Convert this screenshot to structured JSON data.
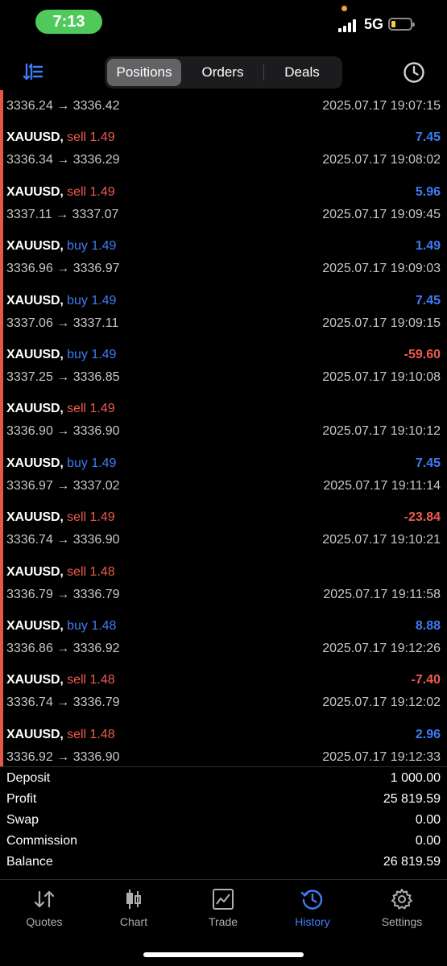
{
  "status": {
    "time": "7:13",
    "network": "5G"
  },
  "toolbar": {
    "segments": [
      {
        "label": "Positions",
        "active": true
      },
      {
        "label": "Orders",
        "active": false
      },
      {
        "label": "Deals",
        "active": false
      }
    ]
  },
  "deals": [
    {
      "symbol": "",
      "side": "",
      "volume": "",
      "prices": "3336.24 → 3336.42",
      "profit": "",
      "time": "2025.07.17 19:07:15"
    },
    {
      "symbol": "XAUUSD,",
      "side": "sell",
      "volume": "1.49",
      "prices": "3336.34 → 3336.29",
      "profit": "7.45",
      "time": "2025.07.17 19:08:02"
    },
    {
      "symbol": "XAUUSD,",
      "side": "sell",
      "volume": "1.49",
      "prices": "3337.11 → 3337.07",
      "profit": "5.96",
      "time": "2025.07.17 19:09:45"
    },
    {
      "symbol": "XAUUSD,",
      "side": "buy",
      "volume": "1.49",
      "prices": "3336.96 → 3336.97",
      "profit": "1.49",
      "time": "2025.07.17 19:09:03"
    },
    {
      "symbol": "XAUUSD,",
      "side": "buy",
      "volume": "1.49",
      "prices": "3337.06 → 3337.11",
      "profit": "7.45",
      "time": "2025.07.17 19:09:15"
    },
    {
      "symbol": "XAUUSD,",
      "side": "buy",
      "volume": "1.49",
      "prices": "3337.25 → 3336.85",
      "profit": "-59.60",
      "time": "2025.07.17 19:10:08"
    },
    {
      "symbol": "XAUUSD,",
      "side": "sell",
      "volume": "1.49",
      "prices": "3336.90 → 3336.90",
      "profit": "",
      "time": "2025.07.17 19:10:12"
    },
    {
      "symbol": "XAUUSD,",
      "side": "buy",
      "volume": "1.49",
      "prices": "3336.97 → 3337.02",
      "profit": "7.45",
      "time": "2025.07.17 19:11:14"
    },
    {
      "symbol": "XAUUSD,",
      "side": "sell",
      "volume": "1.49",
      "prices": "3336.74 → 3336.90",
      "profit": "-23.84",
      "time": "2025.07.17 19:10:21"
    },
    {
      "symbol": "XAUUSD,",
      "side": "sell",
      "volume": "1.48",
      "prices": "3336.79 → 3336.79",
      "profit": "",
      "time": "2025.07.17 19:11:58"
    },
    {
      "symbol": "XAUUSD,",
      "side": "buy",
      "volume": "1.48",
      "prices": "3336.86 → 3336.92",
      "profit": "8.88",
      "time": "2025.07.17 19:12:26"
    },
    {
      "symbol": "XAUUSD,",
      "side": "sell",
      "volume": "1.48",
      "prices": "3336.74 → 3336.79",
      "profit": "-7.40",
      "time": "2025.07.17 19:12:02"
    },
    {
      "symbol": "XAUUSD,",
      "side": "sell",
      "volume": "1.48",
      "prices": "3336.92 → 3336.90",
      "profit": "2.96",
      "time": "2025.07.17 19:12:33"
    }
  ],
  "summary": [
    {
      "label": "Deposit",
      "value": "1 000.00"
    },
    {
      "label": "Profit",
      "value": "25 819.59"
    },
    {
      "label": "Swap",
      "value": "0.00"
    },
    {
      "label": "Commission",
      "value": "0.00"
    },
    {
      "label": "Balance",
      "value": "26 819.59"
    }
  ],
  "tabs": [
    {
      "label": "Quotes",
      "icon": "quotes-arrows-icon",
      "active": false
    },
    {
      "label": "Chart",
      "icon": "candlestick-icon",
      "active": false
    },
    {
      "label": "Trade",
      "icon": "trade-chart-icon",
      "active": false
    },
    {
      "label": "History",
      "icon": "history-clock-icon",
      "active": true
    },
    {
      "label": "Settings",
      "icon": "gear-icon",
      "active": false
    }
  ],
  "colors": {
    "sell": "#f05b4e",
    "buy": "#3e7cf5",
    "accent": "#e8564a",
    "active_tab": "#3e7cf5"
  }
}
